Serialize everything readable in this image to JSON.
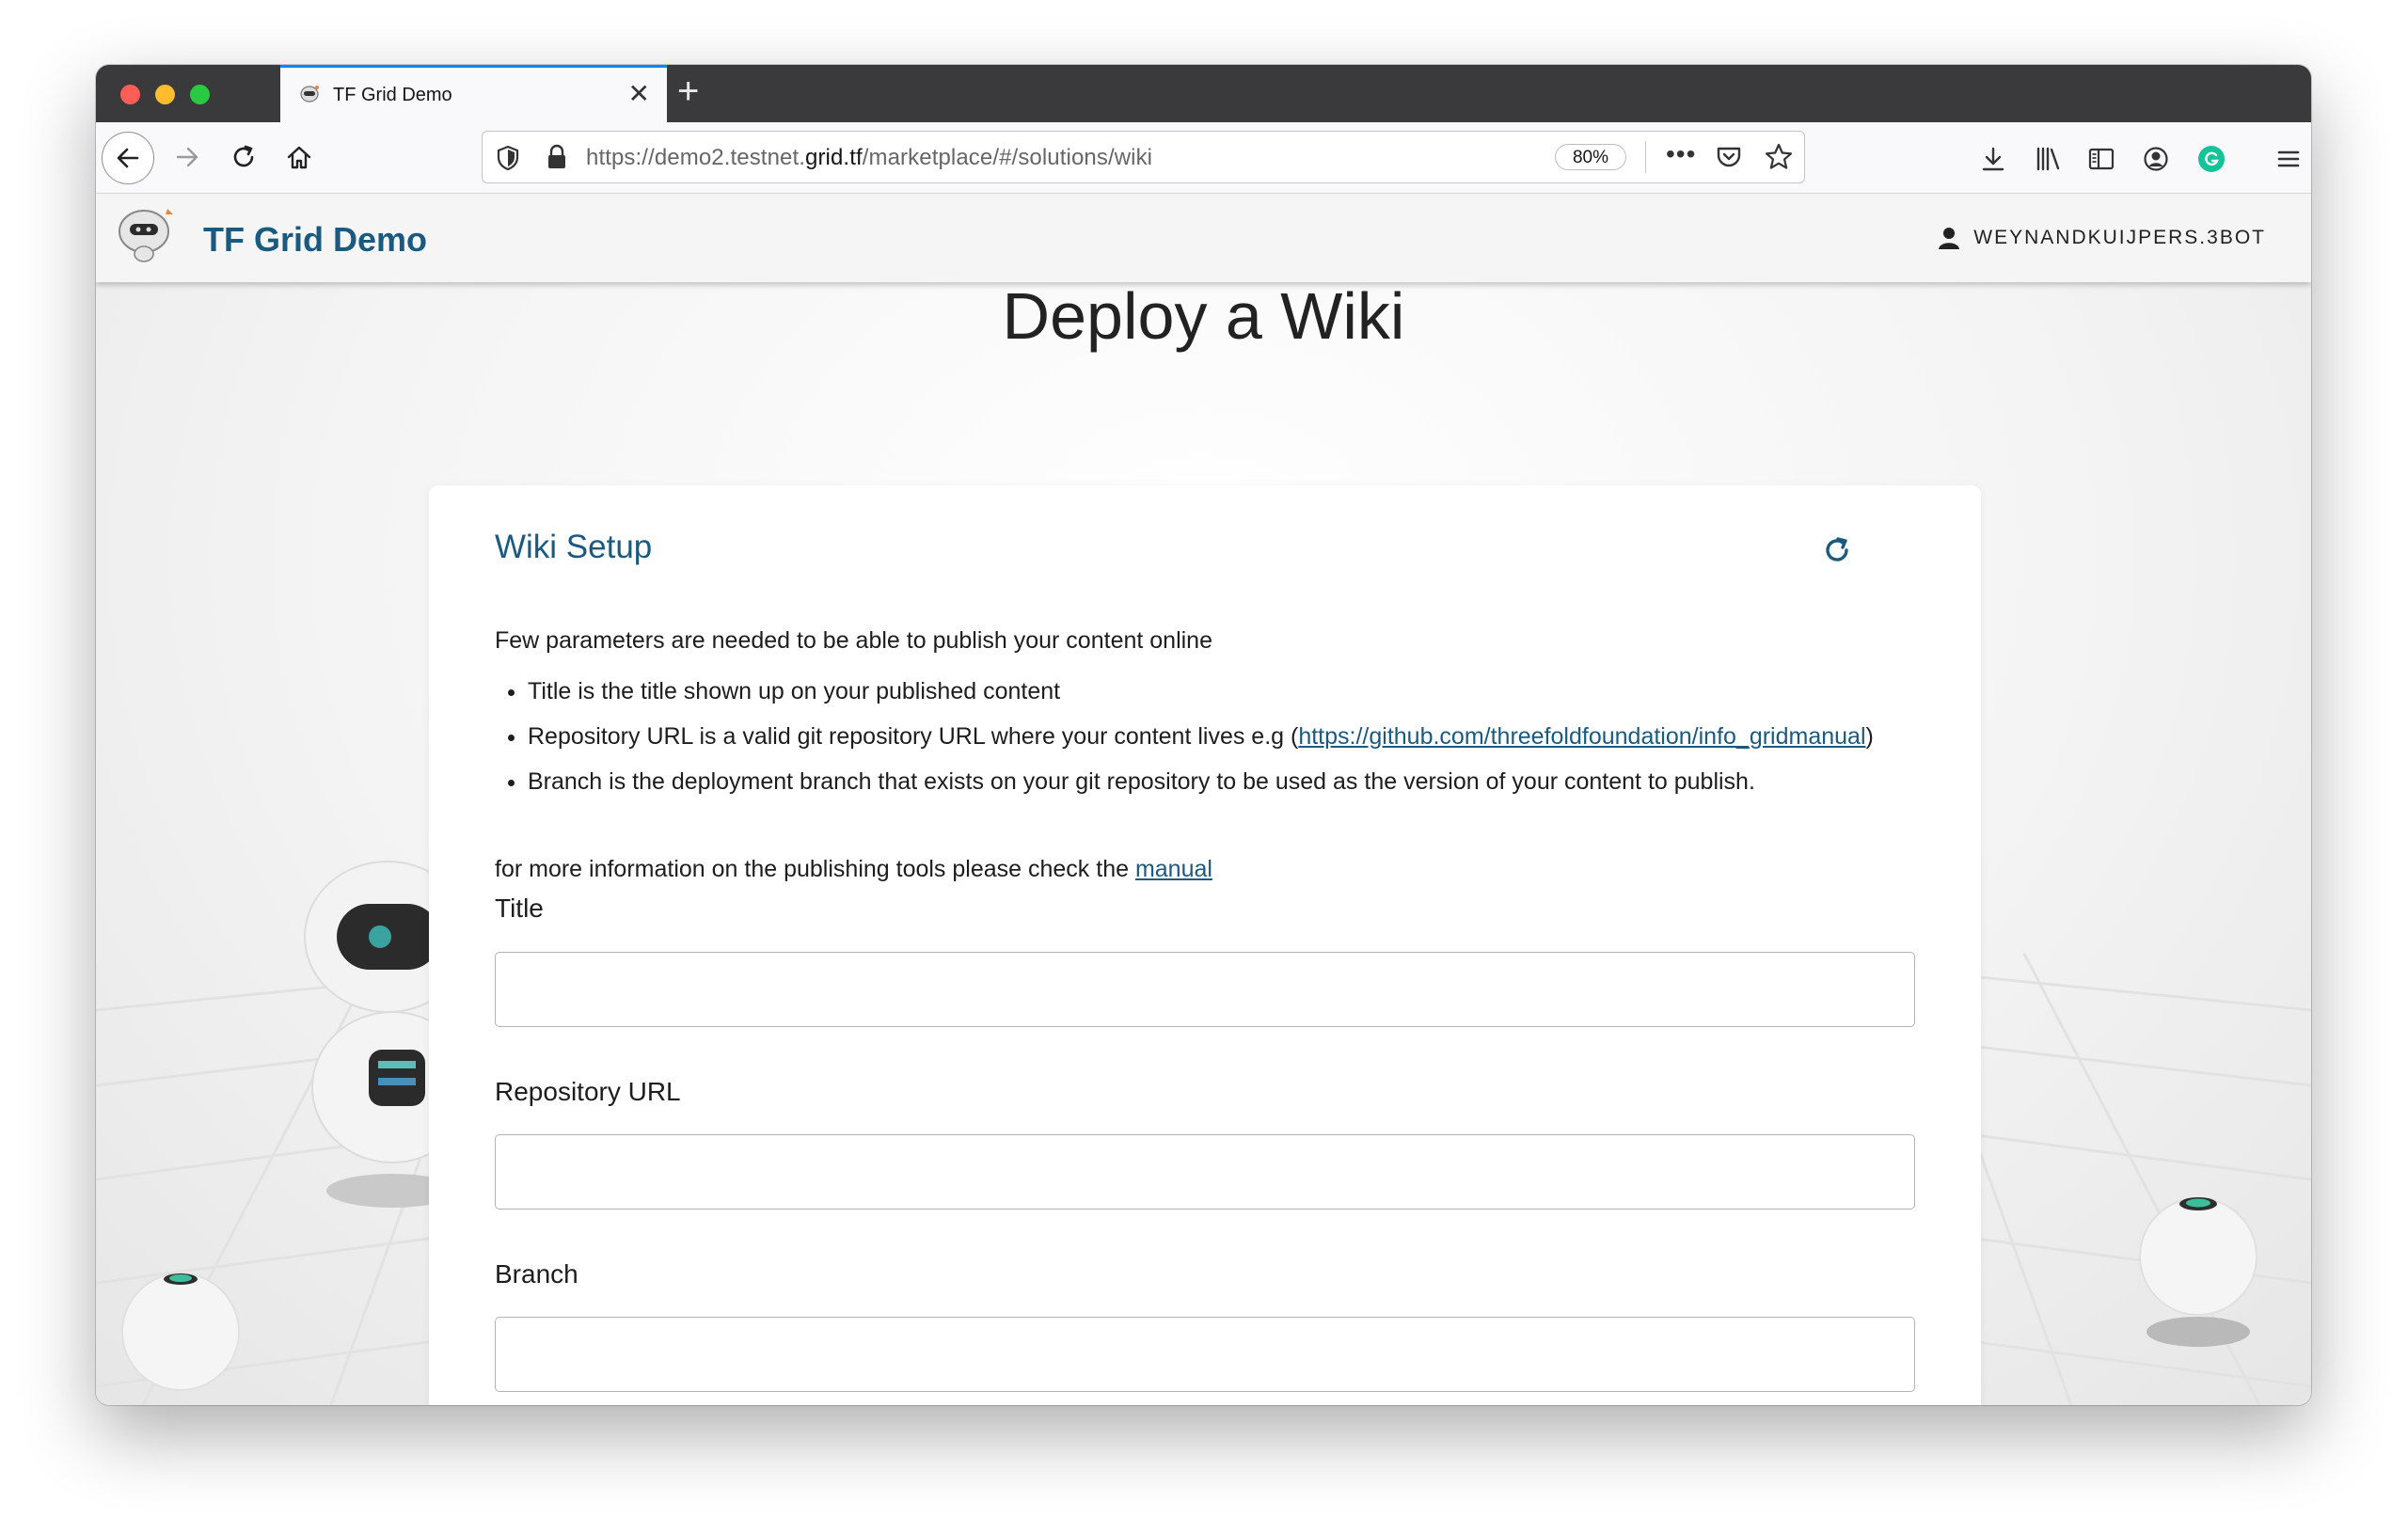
{
  "browser": {
    "tab_title": "TF Grid Demo",
    "tab_close": "✕",
    "new_tab": "+",
    "url_scheme": "https://demo2.testnet.",
    "url_domain": "grid.tf",
    "url_path": "/marketplace/#/solutions/wiki",
    "zoom": "80%",
    "more": "•••",
    "icons": [
      "back-arrow-icon",
      "forward-arrow-icon",
      "reload-icon",
      "home-icon",
      "shield-icon",
      "lock-icon",
      "pocket-icon",
      "star-icon",
      "download-icon",
      "library-icon",
      "sidebar-icon",
      "account-icon",
      "grammarly-icon",
      "hamburger-menu-icon"
    ]
  },
  "app": {
    "title": "TF Grid Demo",
    "user": "WEYNANDKUIJPERS.3BOT"
  },
  "page": {
    "heading": "Deploy a Wiki",
    "card_title": "Wiki Setup",
    "intro": "Few parameters are needed to be able to publish your content online",
    "bullets": {
      "b1": "Title is the title shown up on your published content",
      "b2_pre": "Repository URL is a valid git repository URL where your content lives e.g (",
      "b2_link": "https://github.com/threefoldfoundation/info_gridmanual",
      "b2_post": ")",
      "b3": "Branch is the deployment branch that exists on your git repository to be used as the version of your content to publish."
    },
    "more_info_pre": "for more information on the publishing tools please check the ",
    "more_info_link": "manual"
  },
  "form": {
    "title_label": "Title",
    "title_value": "",
    "repo_label": "Repository URL",
    "repo_value": "",
    "branch_label": "Branch",
    "branch_value": ""
  },
  "colors": {
    "brand": "#1b5a7f",
    "tab_accent": "#0a84ff",
    "grammarly": "#15c39a"
  }
}
